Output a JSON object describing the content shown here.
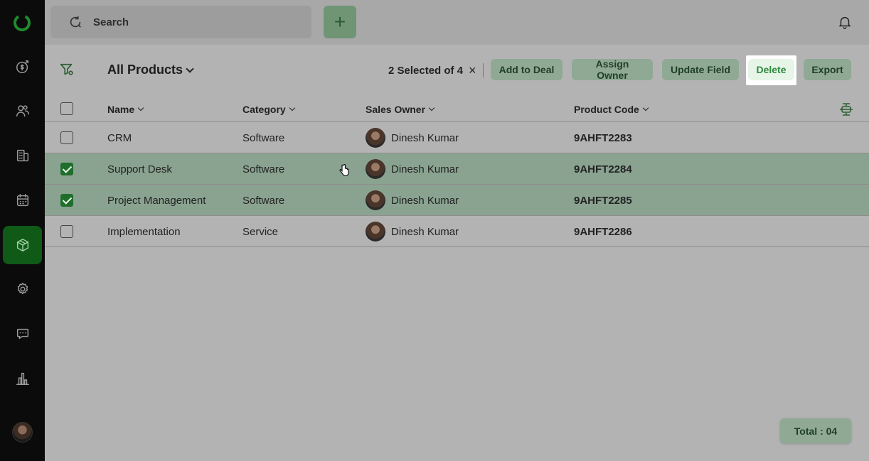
{
  "search": {
    "placeholder": "Search"
  },
  "header": {
    "add_label": "+"
  },
  "view": {
    "title": "All Products"
  },
  "selection": {
    "text": "2 Selected of 4",
    "clear": "×"
  },
  "toolbar": {
    "add_to_deal": "Add to Deal",
    "assign_owner": "Assign Owner",
    "update_field": "Update Field",
    "delete": "Delete",
    "export": "Export"
  },
  "table": {
    "columns": [
      "Name",
      "Category",
      "Sales Owner",
      "Product Code"
    ],
    "rows": [
      {
        "name": "CRM",
        "category": "Software",
        "owner": "Dinesh Kumar",
        "code": "9AHFT2283",
        "selected": false
      },
      {
        "name": "Support Desk",
        "category": "Software",
        "owner": "Dinesh Kumar",
        "code": "9AHFT2284",
        "selected": true
      },
      {
        "name": "Project Management",
        "category": "Software",
        "owner": "Dinesh Kumar",
        "code": "9AHFT2285",
        "selected": true
      },
      {
        "name": "Implementation",
        "category": "Service",
        "owner": "Dinesh Kumar",
        "code": "9AHFT2286",
        "selected": false
      }
    ]
  },
  "footer": {
    "total": "Total : 04"
  },
  "colors": {
    "accent": "#1f6e2c",
    "sidebar": "#0b0b0b",
    "active_nav": "#0f5a17"
  },
  "icons": [
    "logo-icon",
    "deals-icon",
    "contacts-icon",
    "companies-icon",
    "calendar-icon",
    "products-icon",
    "settings-icon",
    "chat-icon",
    "reports-icon",
    "bell-icon",
    "filter-icon",
    "column-settings-icon"
  ]
}
